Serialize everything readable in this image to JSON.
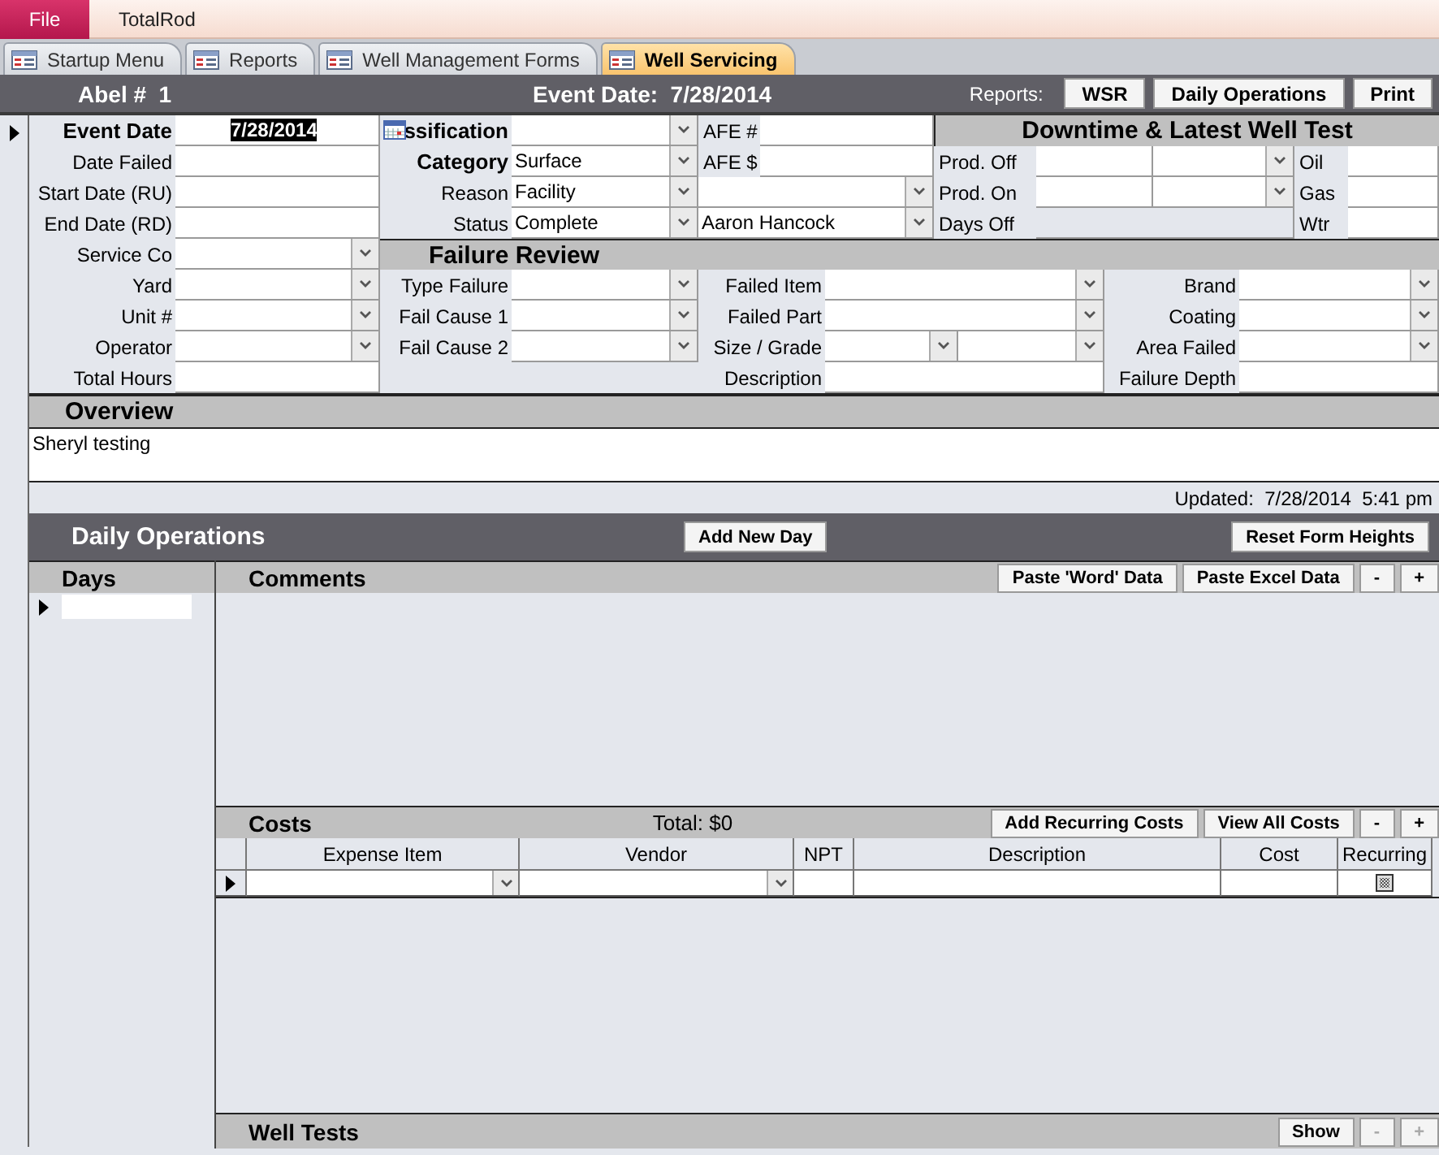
{
  "app_bar": {
    "file_button": "File",
    "title": "TotalRod"
  },
  "tabs": [
    {
      "label": "Startup Menu",
      "selected": false
    },
    {
      "label": "Reports",
      "selected": false
    },
    {
      "label": "Well Management Forms",
      "selected": false
    },
    {
      "label": "Well Servicing",
      "selected": true
    }
  ],
  "header": {
    "record": "Abel #  1",
    "event_date": "Event Date:  7/28/2014",
    "reports_label": "Reports:",
    "buttons": [
      "WSR",
      "Daily Operations",
      "Print"
    ]
  },
  "dates": [
    {
      "label": "Event Date",
      "value": "7/28/2014",
      "kind": "text",
      "focused": true
    },
    {
      "label": "Date Failed",
      "kind": "text",
      "focused": false
    },
    {
      "label": "Start Date (RU)",
      "kind": "text",
      "focused": false
    },
    {
      "label": "End Date (RD)",
      "kind": "text",
      "focused": false
    }
  ],
  "service": [
    {
      "label": "Service Co",
      "kind": "combo"
    },
    {
      "label": "Yard",
      "kind": "combo"
    },
    {
      "label": "Unit #",
      "kind": "combo"
    },
    {
      "label": "Operator",
      "kind": "combo"
    },
    {
      "label": "Total Hours",
      "kind": "text"
    }
  ],
  "classification": [
    {
      "label": "ssification",
      "kind": "combo",
      "bold": true
    },
    {
      "label": "Category",
      "value": "Surface",
      "kind": "combo",
      "bold": true
    },
    {
      "label": "Reason",
      "value": "Facility",
      "kind": "combo",
      "bold": false
    },
    {
      "label": "Status",
      "value": "Complete",
      "kind": "combo",
      "bold": false
    }
  ],
  "afe": [
    {
      "label": "AFE #",
      "kind": "text"
    },
    {
      "label": "AFE $",
      "kind": "text"
    },
    {
      "kind": "combo"
    },
    {
      "value": "Aaron Hancock",
      "kind": "combo"
    }
  ],
  "downtime": {
    "title": "Downtime & Latest Well Test",
    "rows": [
      {
        "label": "Prod. Off",
        "kind": "datetime",
        "test_label": "Oil"
      },
      {
        "label": "Prod. On",
        "kind": "datetime",
        "test_label": "Gas"
      },
      {
        "label": "Days Off",
        "kind": "readonly",
        "test_label": "Wtr"
      }
    ]
  },
  "failure_review": {
    "title": "Failure Review",
    "causes": [
      {
        "label": "Type Failure",
        "kind": "combo"
      },
      {
        "label": "Fail Cause 1",
        "kind": "combo"
      },
      {
        "label": "Fail Cause 2",
        "kind": "combo"
      }
    ],
    "items": [
      {
        "label": "Failed Item",
        "kind": "combo"
      },
      {
        "label": "Failed Part",
        "kind": "combo"
      },
      {
        "label": "Size / Grade",
        "kind": "split_combo"
      },
      {
        "label": "Description",
        "kind": "text"
      }
    ],
    "details": [
      {
        "label": "Brand",
        "kind": "combo"
      },
      {
        "label": "Coating",
        "kind": "combo"
      },
      {
        "label": "Area Failed",
        "kind": "combo"
      },
      {
        "label": "Failure Depth",
        "kind": "text"
      }
    ]
  },
  "overview": {
    "title": "Overview",
    "text": "Sheryl testing",
    "updated": "Updated:  7/28/2014  5:41 pm"
  },
  "daily_operations": {
    "title": "Daily Operations",
    "add_button": "Add New Day",
    "reset_button": "Reset Form Heights"
  },
  "days": {
    "title": "Days"
  },
  "comments": {
    "title": "Comments",
    "buttons": [
      {
        "label": "Paste 'Word' Data",
        "disabled": false
      },
      {
        "label": "Paste Excel Data",
        "disabled": false
      },
      {
        "label": "-",
        "disabled": false
      },
      {
        "label": "+",
        "disabled": false
      }
    ]
  },
  "costs": {
    "title": "Costs",
    "total": "Total: $0",
    "buttons": [
      {
        "label": "Add Recurring Costs",
        "disabled": false
      },
      {
        "label": "View All Costs",
        "disabled": false
      },
      {
        "label": "-",
        "disabled": false
      },
      {
        "label": "+",
        "disabled": false
      }
    ],
    "columns": [
      "Expense Item",
      "Vendor",
      "NPT",
      "Description",
      "Cost",
      "Recurring"
    ]
  },
  "well_tests": {
    "title": "Well Tests",
    "buttons": [
      {
        "label": "Show",
        "disabled": false
      },
      {
        "label": "-",
        "disabled": true
      },
      {
        "label": "+",
        "disabled": true
      }
    ]
  }
}
